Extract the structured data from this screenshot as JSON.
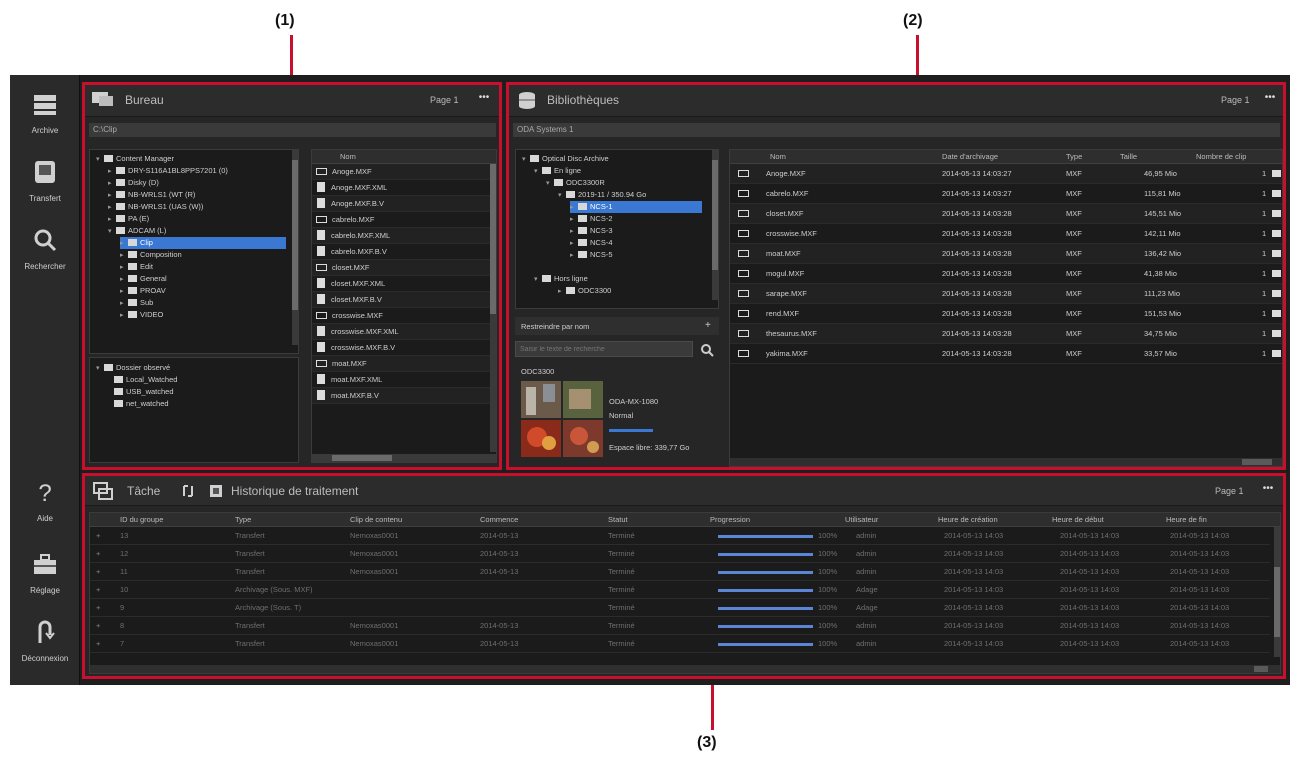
{
  "callouts": {
    "c1": "(1)",
    "c2": "(2)",
    "c3": "(3)"
  },
  "colors": {
    "accent": "#c8102e",
    "selection": "#3a78d4",
    "progress": "#5b86d6"
  },
  "sidebar": {
    "items": [
      {
        "label": "Archive",
        "icon": "archive-icon"
      },
      {
        "label": "Transfert",
        "icon": "transfer-icon"
      },
      {
        "label": "Rechercher",
        "icon": "search-icon"
      },
      {
        "label": "Aide",
        "icon": "help-icon"
      },
      {
        "label": "Réglage",
        "icon": "toolbox-icon"
      },
      {
        "label": "Déconnexion",
        "icon": "logout-icon"
      }
    ]
  },
  "browser": {
    "title": "Bureau",
    "page_label": "Page 1",
    "path": "C:\\Clip",
    "tree": [
      "Content Manager",
      "DRY-S116A1BL8PPS7201 (0)",
      "Disky (D)",
      "NB-WRLS1 (WT (R)",
      "NB-WRLS1 (UAS (W))",
      "PA (E)",
      "ADCAM (L)",
      "Clip",
      "Composition",
      "Edit",
      "General",
      "PROAV",
      "Sub",
      "VIDEO"
    ],
    "watch_root": "Dossier observé",
    "watch_items": [
      "Local_Watched",
      "USB_watched",
      "net_watched"
    ],
    "list_header": "Nom",
    "files": [
      {
        "name": "Anoge.MXF",
        "kind": "clip"
      },
      {
        "name": "Anoge.MXF.XML",
        "kind": "doc"
      },
      {
        "name": "Anoge.MXF.B.V",
        "kind": "doc"
      },
      {
        "name": "cabrelo.MXF",
        "kind": "clip"
      },
      {
        "name": "cabrelo.MXF.XML",
        "kind": "doc"
      },
      {
        "name": "cabrelo.MXF.B.V",
        "kind": "doc"
      },
      {
        "name": "closet.MXF",
        "kind": "clip"
      },
      {
        "name": "closet.MXF.XML",
        "kind": "doc"
      },
      {
        "name": "closet.MXF.B.V",
        "kind": "doc"
      },
      {
        "name": "crosswise.MXF",
        "kind": "clip"
      },
      {
        "name": "crosswise.MXF.XML",
        "kind": "doc"
      },
      {
        "name": "crosswise.MXF.B.V",
        "kind": "doc"
      },
      {
        "name": "moat.MXF",
        "kind": "clip"
      },
      {
        "name": "moat.MXF.XML",
        "kind": "doc"
      },
      {
        "name": "moat.MXF.B.V",
        "kind": "doc"
      }
    ]
  },
  "library": {
    "title": "Bibliothèques",
    "page_label": "Page 1",
    "path": "ODA Systems 1",
    "tree": [
      "Optical Disc Archive",
      "En ligne",
      "ODC3300R",
      "2019-11 / 350.94 Go",
      "NCS-1",
      "NCS-2",
      "NCS-3",
      "NCS-4",
      "NCS-5",
      "Hors ligne",
      "ODC3300"
    ],
    "filter_label": "Restreindre par nom",
    "filter_placeholder": "Saisir le texte de recherche",
    "cart_id": "ODC3300",
    "cart_model": "ODA-MX-1080",
    "cart_status": "Normal",
    "cart_free": "Espace libre: 339,77 Go",
    "columns": [
      "Nom",
      "Date d'archivage",
      "Type",
      "Taille",
      "Nombre de clip"
    ],
    "rows": [
      {
        "name": "Anoge.MXF",
        "date": "2014-05-13 14:03:27",
        "type": "MXF",
        "size": "46,95 Mio",
        "clips": "1"
      },
      {
        "name": "cabrelo.MXF",
        "date": "2014-05-13 14:03:27",
        "type": "MXF",
        "size": "115,81 Mio",
        "clips": "1"
      },
      {
        "name": "closet.MXF",
        "date": "2014-05-13 14:03:28",
        "type": "MXF",
        "size": "145,51 Mio",
        "clips": "1"
      },
      {
        "name": "crosswise.MXF",
        "date": "2014-05-13 14:03:28",
        "type": "MXF",
        "size": "142,11 Mio",
        "clips": "1"
      },
      {
        "name": "moat.MXF",
        "date": "2014-05-13 14:03:28",
        "type": "MXF",
        "size": "136,42 Mio",
        "clips": "1"
      },
      {
        "name": "mogul.MXF",
        "date": "2014-05-13 14:03:28",
        "type": "MXF",
        "size": "41,38 Mio",
        "clips": "1"
      },
      {
        "name": "sarape.MXF",
        "date": "2014-05-13 14:03:28",
        "type": "MXF",
        "size": "111,23 Mio",
        "clips": "1"
      },
      {
        "name": "rend.MXF",
        "date": "2014-05-13 14:03:28",
        "type": "MXF",
        "size": "151,53 Mio",
        "clips": "1"
      },
      {
        "name": "thesaurus.MXF",
        "date": "2014-05-13 14:03:28",
        "type": "MXF",
        "size": "34,75 Mio",
        "clips": "1"
      },
      {
        "name": "yakima.MXF",
        "date": "2014-05-13 14:03:28",
        "type": "MXF",
        "size": "33,57 Mio",
        "clips": "1"
      }
    ]
  },
  "tasks": {
    "title": "Tâche",
    "tab2": "Historique de traitement",
    "page_label": "Page 1",
    "columns": [
      "ID du groupe",
      "Type",
      "Clip de contenu",
      "Commence",
      "Statut",
      "Progression",
      "Utilisateur",
      "Heure de création",
      "Heure de début",
      "Heure de fin"
    ],
    "rows": [
      {
        "id": "13",
        "type": "Transfert",
        "clip": "Nemoxas0001",
        "start": "2014-05-13",
        "status": "Terminé",
        "pct": "100%",
        "user": "admin",
        "created": "2014-05-13 14:03",
        "begin": "2014-05-13 14:03",
        "end": "2014-05-13 14:03",
        "progress": 1.0
      },
      {
        "id": "12",
        "type": "Transfert",
        "clip": "Nemoxas0001",
        "start": "2014-05-13",
        "status": "Terminé",
        "pct": "100%",
        "user": "admin",
        "created": "2014-05-13 14:03",
        "begin": "2014-05-13 14:03",
        "end": "2014-05-13 14:03",
        "progress": 1.0
      },
      {
        "id": "11",
        "type": "Transfert",
        "clip": "Nemoxas0001",
        "start": "2014-05-13",
        "status": "Terminé",
        "pct": "100%",
        "user": "admin",
        "created": "2014-05-13 14:03",
        "begin": "2014-05-13 14:03",
        "end": "2014-05-13 14:03",
        "progress": 1.0
      },
      {
        "id": "10",
        "type": "Archivage (Sous. MXF)",
        "clip": "",
        "start": "",
        "status": "Terminé",
        "pct": "100%",
        "user": "Adage",
        "created": "2014-05-13 14:03",
        "begin": "2014-05-13 14:03",
        "end": "2014-05-13 14:03",
        "progress": 1.0
      },
      {
        "id": "9",
        "type": "Archivage (Sous. T)",
        "clip": "",
        "start": "",
        "status": "Terminé",
        "pct": "100%",
        "user": "Adage",
        "created": "2014-05-13 14:03",
        "begin": "2014-05-13 14:03",
        "end": "2014-05-13 14:03",
        "progress": 1.0
      },
      {
        "id": "8",
        "type": "Transfert",
        "clip": "Nemoxas0001",
        "start": "2014-05-13",
        "status": "Terminé",
        "pct": "100%",
        "user": "admin",
        "created": "2014-05-13 14:03",
        "begin": "2014-05-13 14:03",
        "end": "2014-05-13 14:03",
        "progress": 1.0
      },
      {
        "id": "7",
        "type": "Transfert",
        "clip": "Nemoxas0001",
        "start": "2014-05-13",
        "status": "Terminé",
        "pct": "100%",
        "user": "admin",
        "created": "2014-05-13 14:03",
        "begin": "2014-05-13 14:03",
        "end": "2014-05-13 14:03",
        "progress": 1.0
      }
    ]
  }
}
